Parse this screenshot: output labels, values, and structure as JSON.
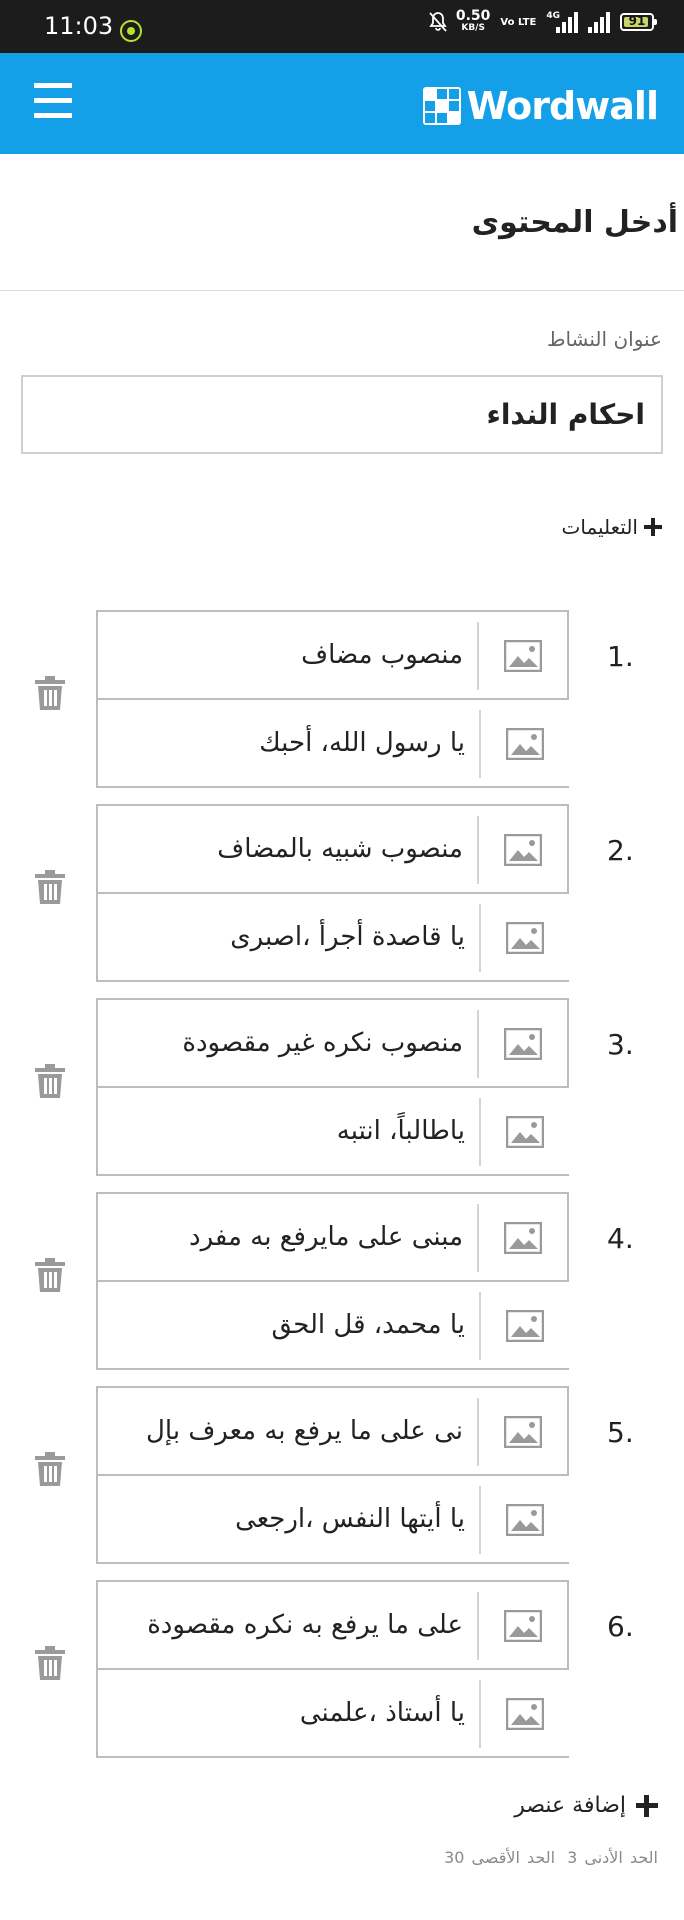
{
  "status_bar": {
    "time": "11:03",
    "speed_value": "0.50",
    "speed_unit": "KB/S",
    "volte": "Vo LTE",
    "network": "4G",
    "battery": "91",
    "battery_level": 0.91
  },
  "header": {
    "brand": "Wordwall",
    "menu_icon": "hamburger-icon",
    "logo_icon": "wordwall-logo-icon",
    "color": "#14a0e8"
  },
  "page": {
    "title": "أدخل المحتوى",
    "activity_title_label": "عنوان النشاط",
    "activity_title_value": "احكام النداء",
    "instructions_label": "التعليمات"
  },
  "items": [
    {
      "number": "1.",
      "top": "منصوب مضاف",
      "bottom": "يا رسول الله، أحبك"
    },
    {
      "number": "2.",
      "top": "منصوب شبيه بالمضاف",
      "bottom": "يا قاصدة أجرأ ،اصبرى"
    },
    {
      "number": "3.",
      "top": "منصوب نكره غير مقصودة",
      "bottom": "ياطالباً، انتبه"
    },
    {
      "number": "4.",
      "top": "مبنى على مايرفع به مفرد",
      "bottom": "يا محمد، قل الحق"
    },
    {
      "number": "5.",
      "top": "نى على ما يرفع به معرف بإل",
      "bottom": "يا أيتها النفس ،ارجعى"
    },
    {
      "number": "6.",
      "top": "على ما يرفع به نكره مقصودة",
      "bottom": "يا أستاذ ،علمنى"
    }
  ],
  "footer": {
    "add_item": "إضافة عنصر",
    "min_label": "الحد الأدنى 3",
    "max_label": "الحد الأقصى 30"
  }
}
